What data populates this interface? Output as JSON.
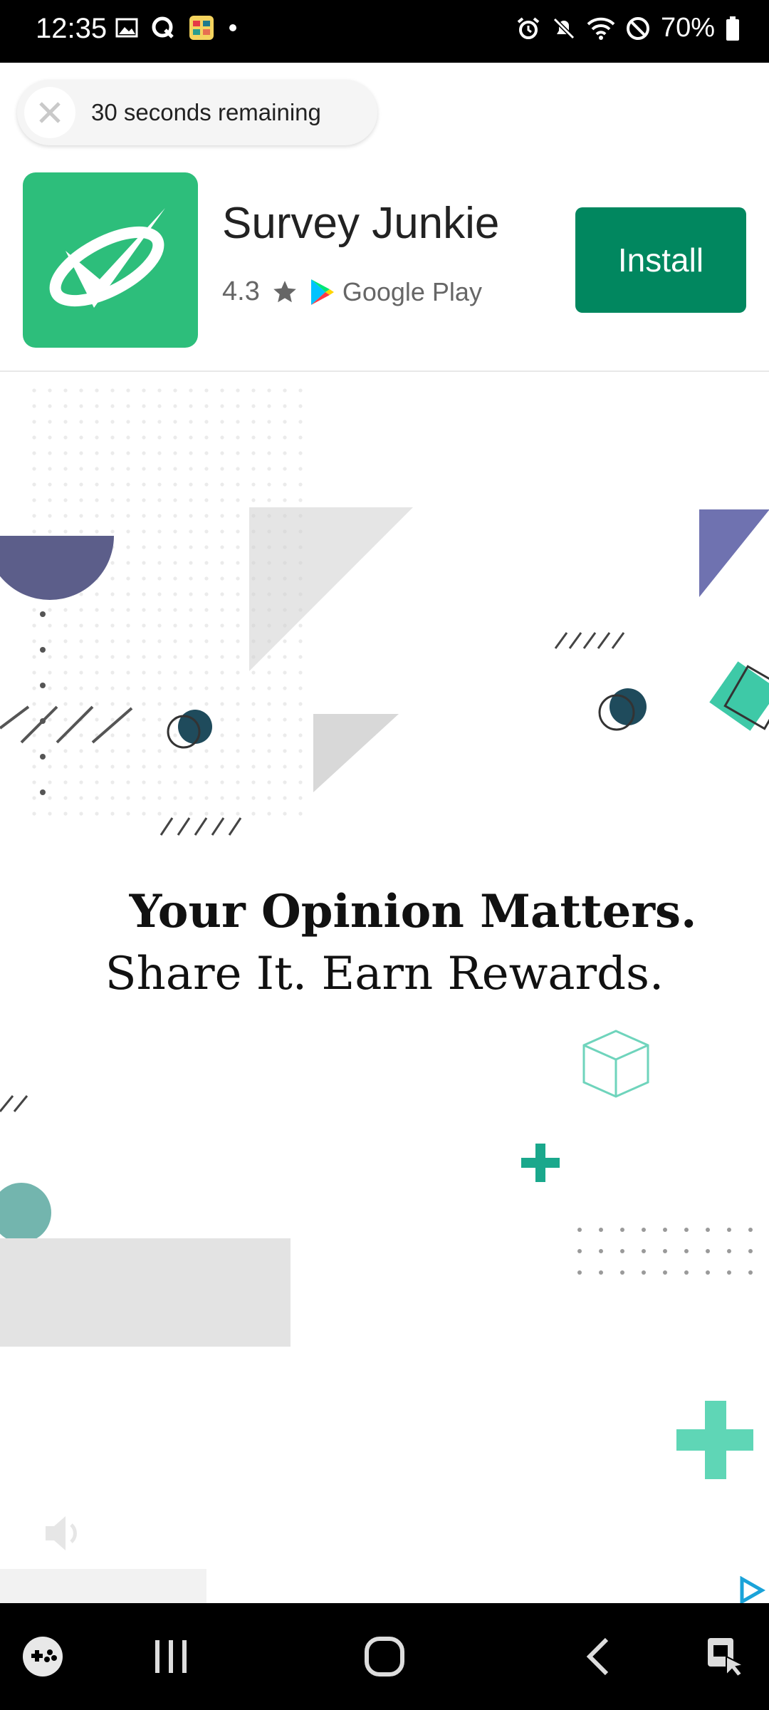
{
  "status_bar": {
    "time": "12:35",
    "battery": "70%"
  },
  "ad": {
    "timer_text": "30 seconds remaining",
    "app_name": "Survey Junkie",
    "rating": "4.3",
    "store_name": "Google Play",
    "install_label": "Install",
    "headline_line1": "Your Opinion Matters.",
    "headline_line2": "Share It. Earn Rewards.",
    "colors": {
      "icon_bg": "#2dbe7b",
      "install_bg": "#01875f",
      "accent_teal": "#3ec9a7",
      "navy_shape": "#5c5e8a"
    }
  },
  "nav_bar": {
    "items": [
      "game-launcher-icon",
      "recent-apps-icon",
      "home-icon",
      "back-icon",
      "assistant-icon"
    ]
  }
}
